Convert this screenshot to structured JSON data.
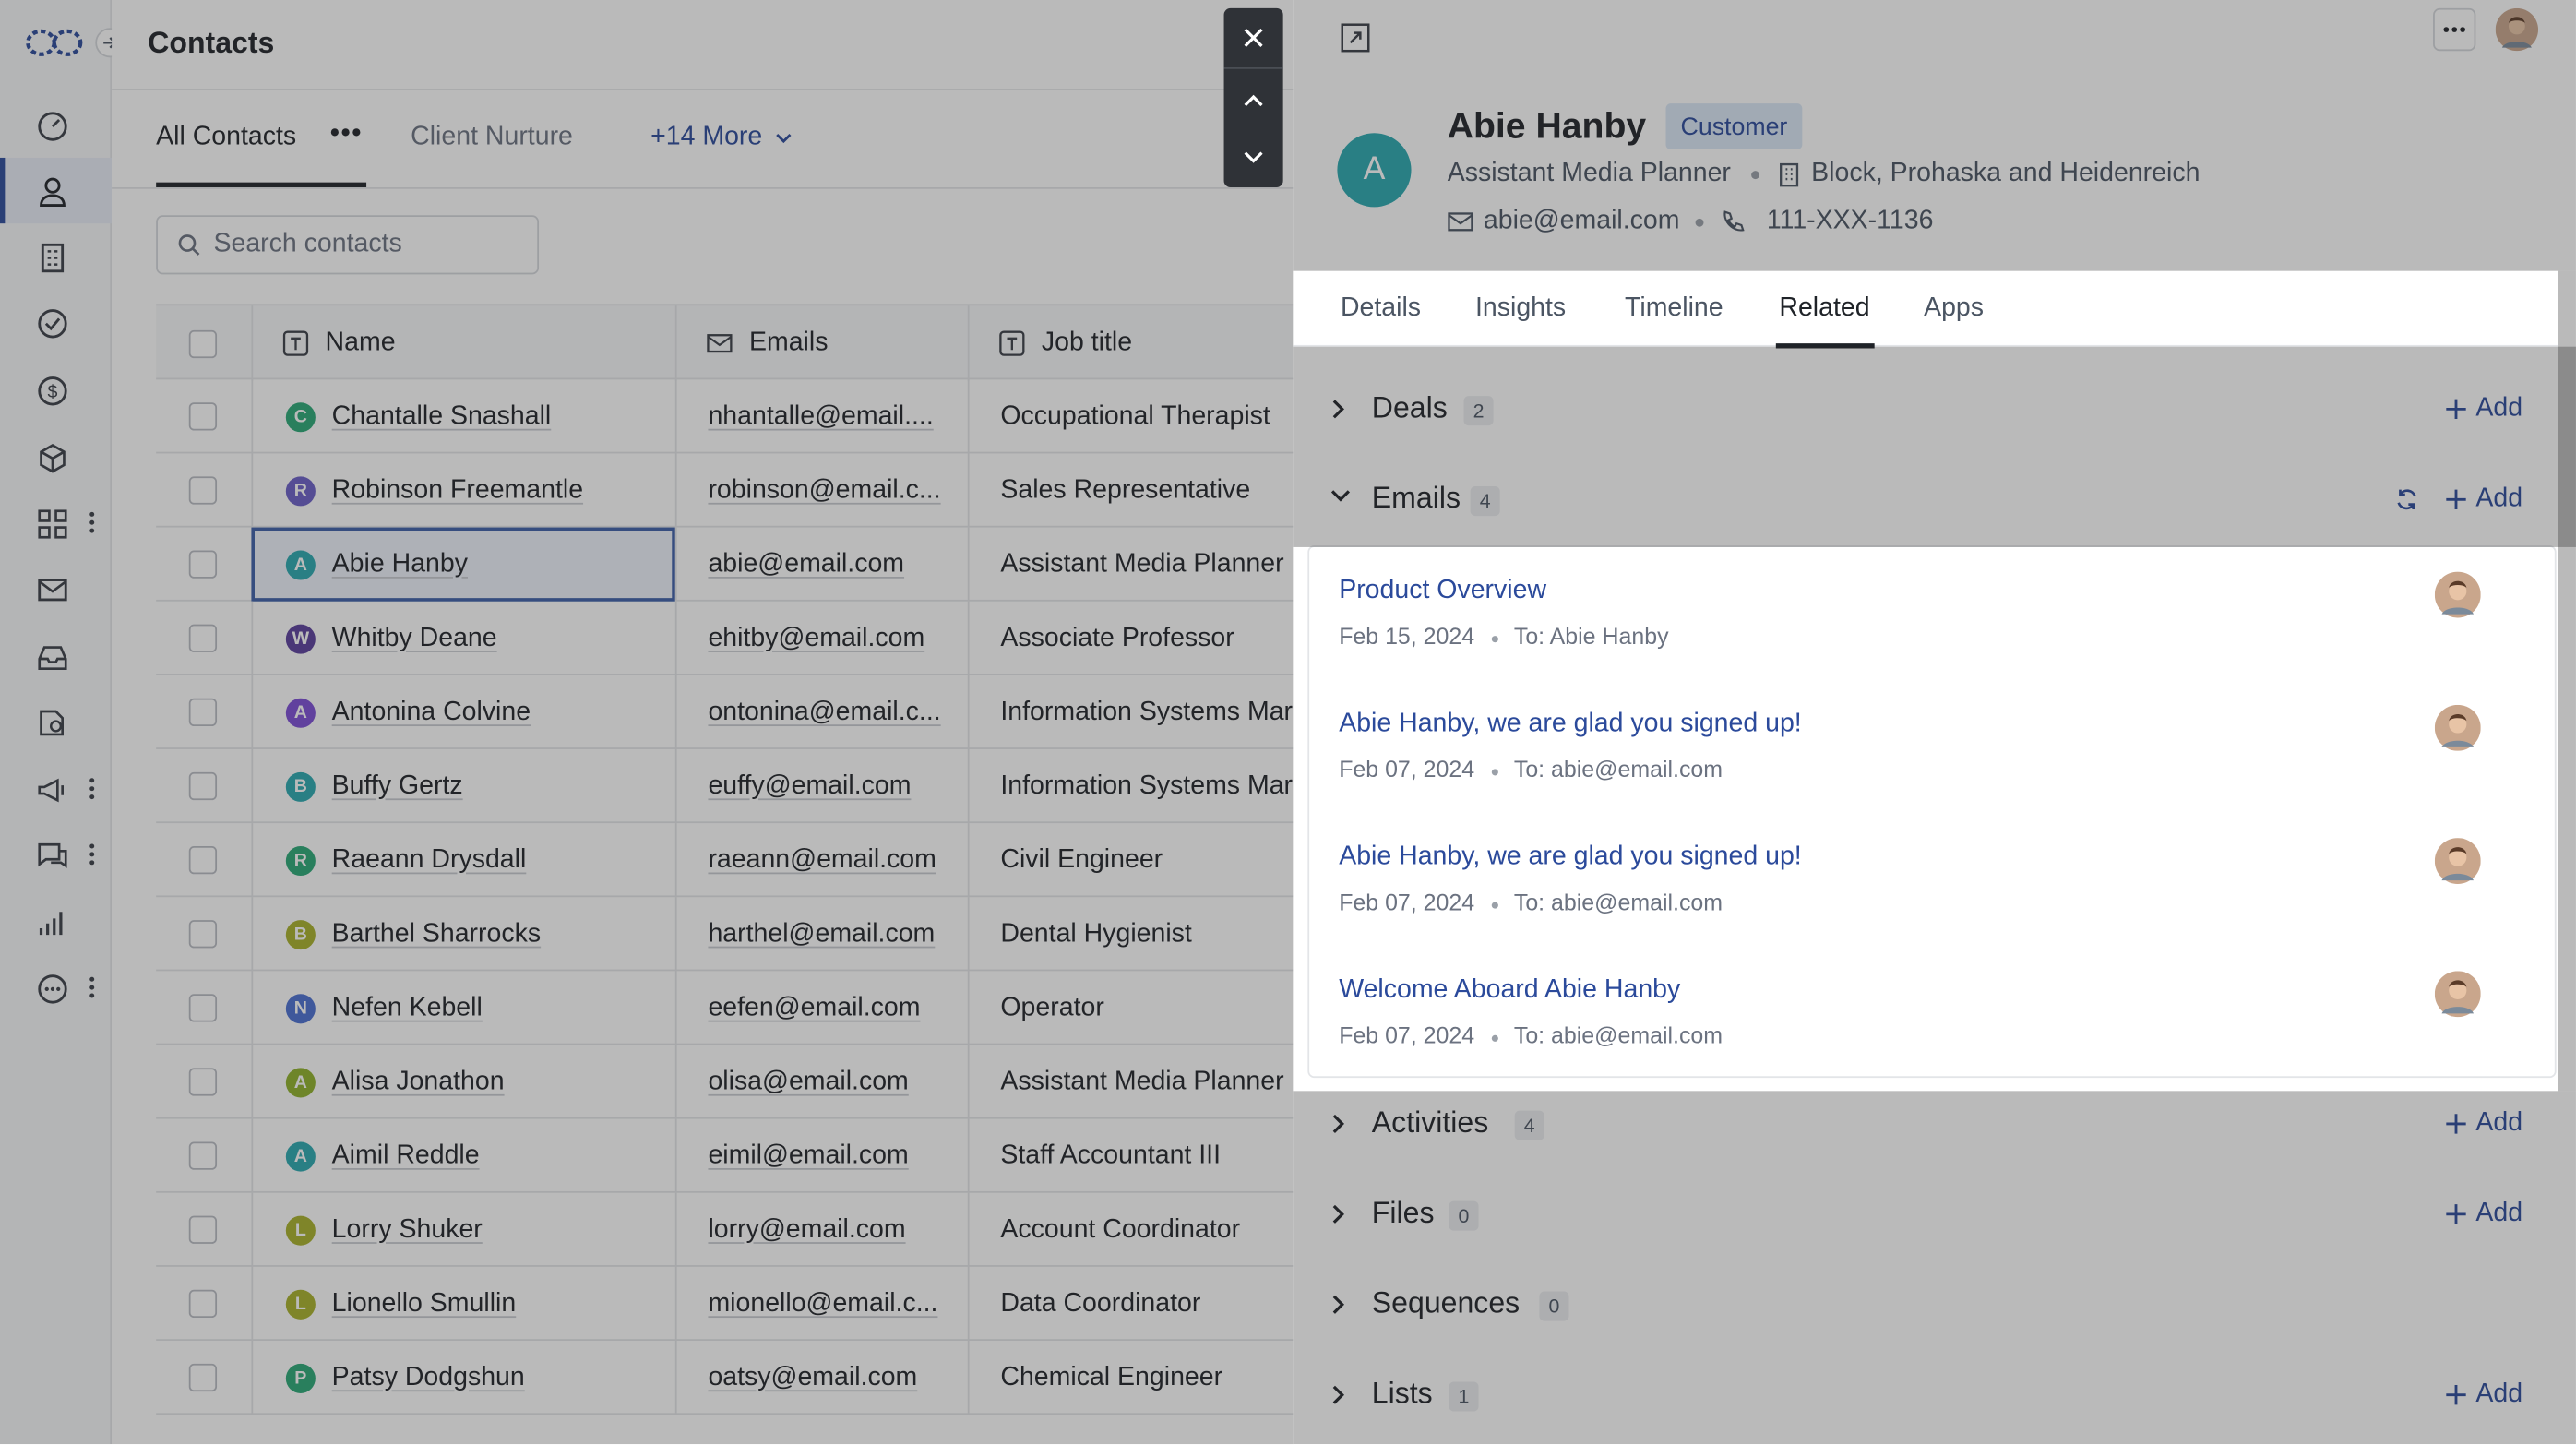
{
  "main": {
    "title": "Contacts",
    "tabs": {
      "all": "All Contacts",
      "menu": "•••",
      "client": "Client Nurture",
      "more": "+14 More"
    },
    "search_placeholder": "Search contacts",
    "columns": {
      "name": "Name",
      "emails": "Emails",
      "job": "Job title"
    },
    "rows": [
      {
        "initial": "C",
        "color": "#2aa876",
        "name": "Chantalle Snashall",
        "email": "nhantalle@email....",
        "job": "Occupational Therapist"
      },
      {
        "initial": "R",
        "color": "#6b5fc7",
        "name": "Robinson Freemantle",
        "email": "robinson@email.c...",
        "job": "Sales Representative"
      },
      {
        "initial": "A",
        "color": "#2aa8b0",
        "name": "Abie Hanby",
        "email": "abie@email.com",
        "job": "Assistant Media Planner"
      },
      {
        "initial": "W",
        "color": "#5a3e9c",
        "name": "Whitby Deane",
        "email": "ehitby@email.com",
        "job": "Associate Professor"
      },
      {
        "initial": "A",
        "color": "#7c4dd6",
        "name": "Antonina Colvine",
        "email": "ontonina@email.c...",
        "job": "Information Systems Mar"
      },
      {
        "initial": "B",
        "color": "#2aa8b0",
        "name": "Buffy Gertz",
        "email": "euffy@email.com",
        "job": "Information Systems Mar"
      },
      {
        "initial": "R",
        "color": "#2aa876",
        "name": "Raeann Drysdall",
        "email": "raeann@email.com",
        "job": "Civil Engineer"
      },
      {
        "initial": "B",
        "color": "#a8b22a",
        "name": "Barthel Sharrocks",
        "email": "harthel@email.com",
        "job": "Dental Hygienist"
      },
      {
        "initial": "N",
        "color": "#4a6fd1",
        "name": "Nefen Kebell",
        "email": "eefen@email.com",
        "job": "Operator"
      },
      {
        "initial": "A",
        "color": "#8fb22a",
        "name": "Alisa Jonathon",
        "email": "olisa@email.com",
        "job": "Assistant Media Planner"
      },
      {
        "initial": "A",
        "color": "#2aa8b0",
        "name": "Aimil Reddle",
        "email": "eimil@email.com",
        "job": "Staff Accountant III"
      },
      {
        "initial": "L",
        "color": "#a8b22a",
        "name": "Lorry Shuker",
        "email": "lorry@email.com",
        "job": "Account Coordinator"
      },
      {
        "initial": "L",
        "color": "#a8b22a",
        "name": "Lionello Smullin",
        "email": "mionello@email.c...",
        "job": "Data Coordinator"
      },
      {
        "initial": "P",
        "color": "#2aa876",
        "name": "Patsy Dodgshun",
        "email": "oatsy@email.com",
        "job": "Chemical Engineer"
      }
    ]
  },
  "panel": {
    "avatar_initial": "A",
    "name": "Abie Hanby",
    "badge": "Customer",
    "job": "Assistant Media Planner",
    "company": "Block, Prohaska and Heidenreich",
    "email": "abie@email.com",
    "phone": "111-XXX-1136",
    "tabs": [
      "Details",
      "Insights",
      "Timeline",
      "Related",
      "Apps"
    ],
    "add_label": "Add",
    "sections": {
      "deals": {
        "title": "Deals",
        "count": "2"
      },
      "emails": {
        "title": "Emails",
        "count": "4"
      },
      "activities": {
        "title": "Activities",
        "count": "4"
      },
      "files": {
        "title": "Files",
        "count": "0"
      },
      "sequences": {
        "title": "Sequences",
        "count": "0"
      },
      "lists": {
        "title": "Lists",
        "count": "1"
      }
    },
    "emails": [
      {
        "subject": "Product Overview",
        "date": "Feb 15, 2024",
        "to": "To: Abie Hanby"
      },
      {
        "subject": "Abie Hanby, we are glad you signed up!",
        "date": "Feb 07, 2024",
        "to": "To: abie@email.com"
      },
      {
        "subject": "Abie Hanby, we are glad you signed up!",
        "date": "Feb 07, 2024",
        "to": "To: abie@email.com"
      },
      {
        "subject": "Welcome Aboard Abie Hanby",
        "date": "Feb 07, 2024",
        "to": "To: abie@email.com"
      }
    ]
  },
  "icons": {
    "nav": [
      "dashboard-icon",
      "contacts-icon",
      "companies-icon",
      "tasks-icon",
      "deals-icon",
      "products-icon",
      "apps-icon",
      "email-icon",
      "inbox-icon",
      "reports-icon",
      "campaigns-icon",
      "chat-icon",
      "analytics-icon",
      "more-icon"
    ]
  },
  "colors": {
    "accent": "#2b4a9b",
    "teal": "#2aa8b0",
    "badge_bg": "#dbe7f7"
  }
}
